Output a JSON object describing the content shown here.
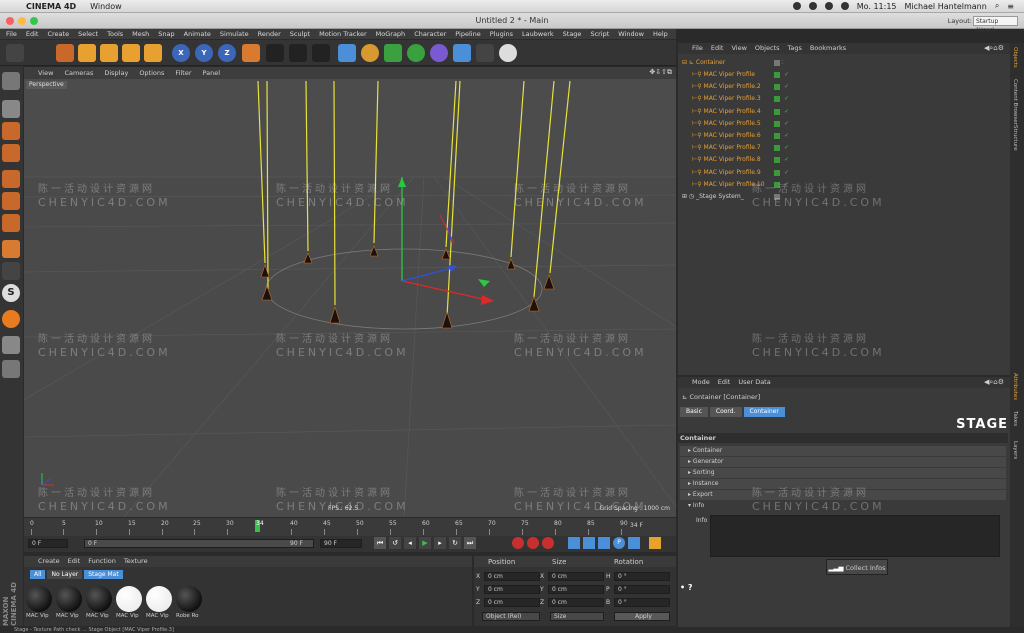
{
  "mac": {
    "app": "CINEMA 4D",
    "window_menu": "Window",
    "clock": "Mo. 11:15",
    "user": "Michael Hantelmann"
  },
  "window": {
    "title": "Untitled 2 * - Main",
    "layout_label": "Layout:",
    "layout_value": "Startup (User)"
  },
  "menus": [
    "File",
    "Edit",
    "Create",
    "Select",
    "Tools",
    "Mesh",
    "Snap",
    "Animate",
    "Simulate",
    "Render",
    "Sculpt",
    "Motion Tracker",
    "MoGraph",
    "Character",
    "Pipeline",
    "Plugins",
    "Laubwerk",
    "Stage",
    "Script",
    "Window",
    "Help"
  ],
  "viewport": {
    "menus": [
      "View",
      "Cameras",
      "Display",
      "Options",
      "Filter",
      "Panel"
    ],
    "camera": "Perspective",
    "fps": "FPS : 62.5",
    "grid": "Grid Spacing : 1000 cm"
  },
  "timeline": {
    "ticks": [
      "0",
      "5",
      "10",
      "15",
      "20",
      "25",
      "30",
      "34",
      "40",
      "45",
      "50",
      "55",
      "60",
      "65",
      "70",
      "75",
      "80",
      "85",
      "90"
    ],
    "current": "34 F",
    "start": "0 F",
    "end": "90 F",
    "range_start": "0 F",
    "range_end": "90 F"
  },
  "materials": {
    "menus": [
      "Create",
      "Edit",
      "Function",
      "Texture"
    ],
    "filters": [
      "All",
      "No Layer",
      "Stage Mat"
    ],
    "items": [
      "MAC Vip",
      "MAC Vip",
      "MAC Vip",
      "MAC Vip",
      "MAC Vip",
      "Robe Ro"
    ]
  },
  "coords": {
    "headers": [
      "Position",
      "Size",
      "Rotation"
    ],
    "rows": [
      {
        "a": "X",
        "v1": "0 cm",
        "b": "X",
        "v2": "0 cm",
        "c": "H",
        "v3": "0 °"
      },
      {
        "a": "Y",
        "v1": "0 cm",
        "b": "Y",
        "v2": "0 cm",
        "c": "P",
        "v3": "0 °"
      },
      {
        "a": "Z",
        "v1": "0 cm",
        "b": "Z",
        "v2": "0 cm",
        "c": "B",
        "v3": "0 °"
      }
    ],
    "mode": "Object (Rel)",
    "size_mode": "Size",
    "apply": "Apply"
  },
  "objects": {
    "menus": [
      "File",
      "Edit",
      "View",
      "Objects",
      "Tags",
      "Bookmarks"
    ],
    "root": "Container",
    "items": [
      "MAC Viper Profile",
      "MAC Viper Profile.2",
      "MAC Viper Profile.3",
      "MAC Viper Profile.4",
      "MAC Viper Profile.5",
      "MAC Viper Profile.6",
      "MAC Viper Profile.7",
      "MAC Viper Profile.8",
      "MAC Viper Profile.9",
      "MAC Viper Profile.10"
    ],
    "system": "_Stage System_"
  },
  "attributes": {
    "menus": [
      "Mode",
      "Edit",
      "User Data"
    ],
    "object": "Container [Container]",
    "tabs": [
      "Basic",
      "Coord.",
      "Container"
    ],
    "logo": "STAGE",
    "section": "Container",
    "groups": [
      "Container",
      "Generator",
      "Sorting",
      "Instance",
      "Export",
      "Info"
    ],
    "info_label": "Info",
    "collect": "Collect Infos"
  },
  "right_tabs": [
    "Objects",
    "Content Browser",
    "Structure",
    "Attributes",
    "Takes",
    "Layers"
  ],
  "status": "Stage - Texture Path check ... Stage Object [MAC Viper Profile.3]",
  "watermark": {
    "cn": "陈一活动设计资源网",
    "en": "CHENYIC4D.COM"
  },
  "colors": {
    "accent": "#4a8fd8",
    "object_orange": "#e08a2a",
    "light_beam": "#e8e23a"
  }
}
